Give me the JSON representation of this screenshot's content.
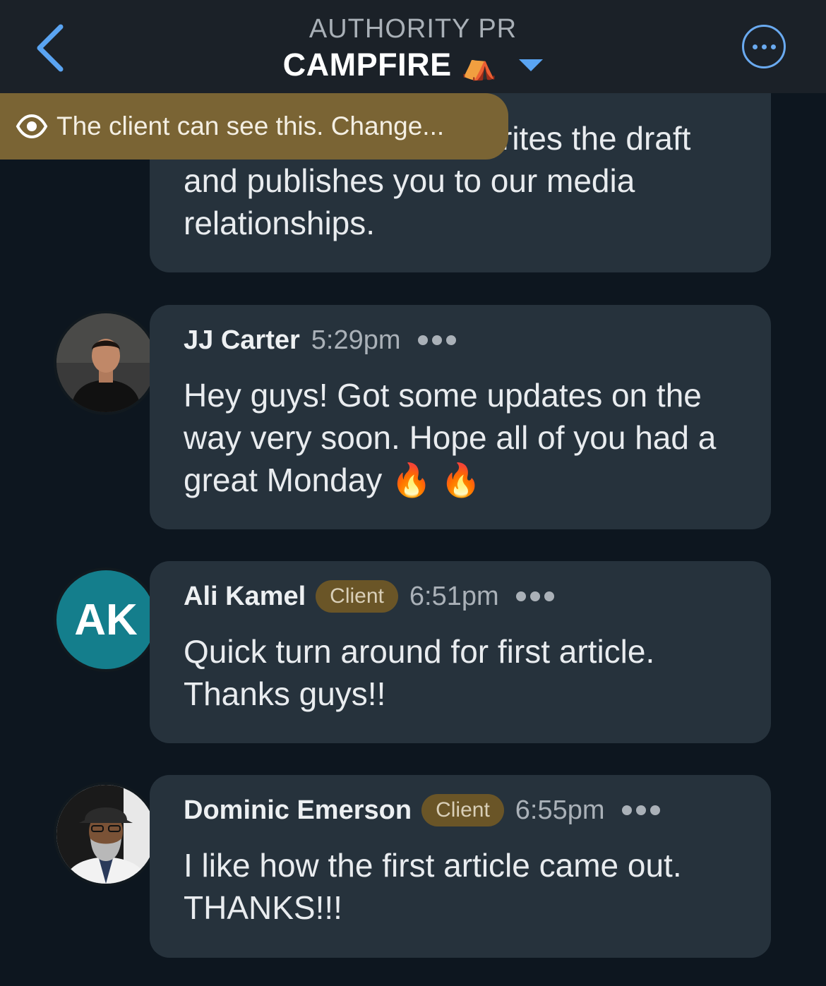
{
  "header": {
    "subtitle": "AUTHORITY PR",
    "title": "CAMPFIRE",
    "title_emoji": "⛺"
  },
  "visibility_banner": {
    "text": "The client can see this. Change..."
  },
  "messages": [
    {
      "text": "rites the draft and publishes you to our media relationships."
    },
    {
      "author": "JJ Carter",
      "time": "5:29pm",
      "text": "Hey guys! Got some updates on the way very soon. Hope all of you had a great Monday 🔥 🔥"
    },
    {
      "author": "Ali Kamel",
      "badge": "Client",
      "time": "6:51pm",
      "initials": "AK",
      "avatar_color": "#147e8c",
      "text": "Quick turn around for first article. Thanks guys!!"
    },
    {
      "author": "Dominic Emerson",
      "badge": "Client",
      "time": "6:55pm",
      "text": "I like how the first article came out. THANKS!!!"
    }
  ],
  "colors": {
    "background": "#0d161f",
    "bubble": "#26323c",
    "accent_blue": "#6aaaf0",
    "client_badge": "#6a5527",
    "banner": "#7a6434"
  }
}
